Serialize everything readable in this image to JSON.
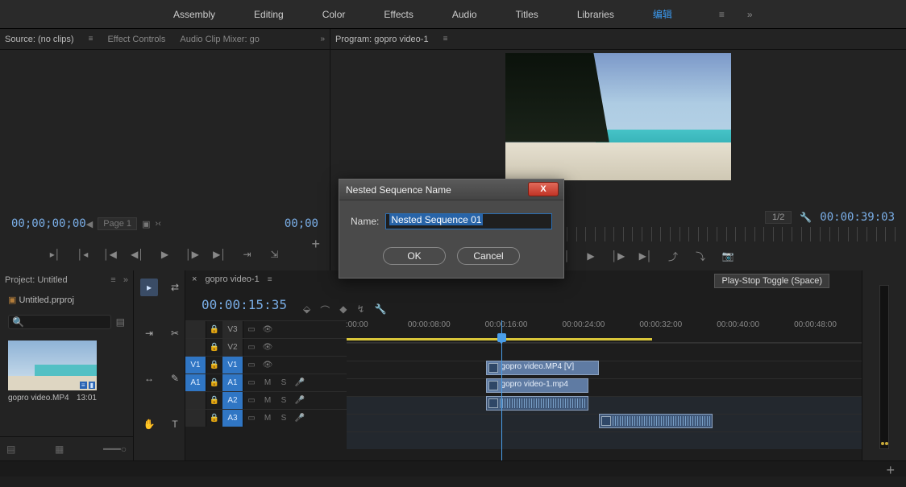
{
  "workspaces": [
    "Assembly",
    "Editing",
    "Color",
    "Effects",
    "Audio",
    "Titles",
    "Libraries"
  ],
  "workspace_edit": "编辑",
  "source": {
    "tabs": [
      "Source: (no clips)",
      "Effect Controls",
      "Audio Clip Mixer: go"
    ],
    "tc_left": "00;00;00;00",
    "tc_right": "00;00",
    "page_label": "Page 1"
  },
  "program": {
    "tab": "Program: gopro video-1",
    "tc_right": "00:00:39:03",
    "scale": "1/2",
    "toggle_text": "Play-Stop Toggle (Space)"
  },
  "project": {
    "tab": "Project: Untitled",
    "file": "Untitled.prproj",
    "clip_name": "gopro video.MP4",
    "clip_dur": "13:01"
  },
  "timeline": {
    "seq_tab": "gopro video-1",
    "tc": "00:00:15:35",
    "ruler": [
      ":00:00",
      "00:00:08:00",
      "00:00:16:00",
      "00:00:24:00",
      "00:00:32:00",
      "00:00:40:00",
      "00:00:48:00"
    ],
    "tracks": {
      "v3": "V3",
      "v2": "V2",
      "v1": "V1",
      "a1": "A1",
      "a2": "A2",
      "a3": "A3"
    },
    "src_patches": {
      "v1": "V1",
      "a1": "A1"
    },
    "clip_v2": "gopro video.MP4 [V]",
    "clip_v1": "gopro video-1.mp4"
  },
  "dialog": {
    "title": "Nested Sequence Name",
    "label": "Name:",
    "value": "Nested Sequence 01",
    "ok": "OK",
    "cancel": "Cancel"
  }
}
